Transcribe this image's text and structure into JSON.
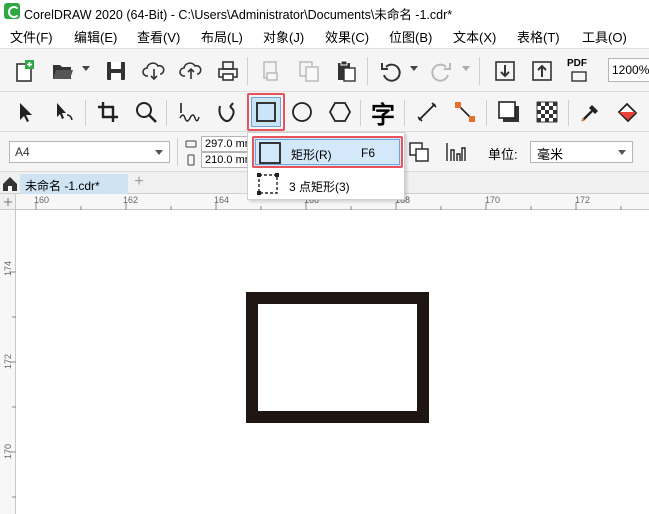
{
  "window": {
    "title": "CorelDRAW 2020 (64-Bit) - C:\\Users\\Administrator\\Documents\\未命名 -1.cdr*"
  },
  "menubar": {
    "items": [
      "文件(F)",
      "编辑(E)",
      "查看(V)",
      "布局(L)",
      "对象(J)",
      "效果(C)",
      "位图(B)",
      "文本(X)",
      "表格(T)",
      "工具(O)"
    ]
  },
  "standard_toolbar": {
    "icons": [
      "new-document-icon",
      "open-folder-icon",
      "save-icon",
      "cloud-download-icon",
      "cloud-upload-icon",
      "print-icon",
      "cut-icon",
      "copy-icon",
      "paste-icon",
      "undo-icon",
      "redo-icon",
      "import-icon",
      "export-icon",
      "pdf-icon"
    ],
    "pdf_label": "PDF",
    "zoom_value": "1200%"
  },
  "toolbox": {
    "icons": [
      "pick-tool-icon",
      "shape-tool-icon",
      "crop-tool-icon",
      "zoom-tool-icon",
      "freehand-tool-icon",
      "artistic-media-icon",
      "rectangle-tool-icon",
      "ellipse-tool-icon",
      "polygon-tool-icon",
      "text-tool-icon",
      "dimension-tool-icon",
      "connector-tool-icon",
      "drop-shadow-icon",
      "transparency-icon",
      "eyedropper-icon",
      "interactive-fill-icon"
    ],
    "text_tool_glyph": "字",
    "selected_tool": "rectangle-tool-icon"
  },
  "property_bar": {
    "page_size": "A4",
    "width": "297.0 mm",
    "height": "210.0 mm",
    "units_label": "单位:",
    "units_value": "毫米"
  },
  "tabs": {
    "document_tab": "未命名 -1.cdr*",
    "add_tab": "+"
  },
  "ruler": {
    "h_labels": [
      "160",
      "162",
      "164",
      "166",
      "168",
      "170",
      "172"
    ],
    "v_labels": [
      "174",
      "172",
      "170"
    ]
  },
  "flyout": {
    "items": [
      {
        "label": "矩形(R)",
        "shortcut": "F6"
      },
      {
        "label": "3 点矩形(3)",
        "shortcut": ""
      }
    ]
  },
  "colors": {
    "accent_highlight": "#e8525a",
    "selection_blue": "#cce4f7",
    "rect_outline": "#1f1512"
  }
}
